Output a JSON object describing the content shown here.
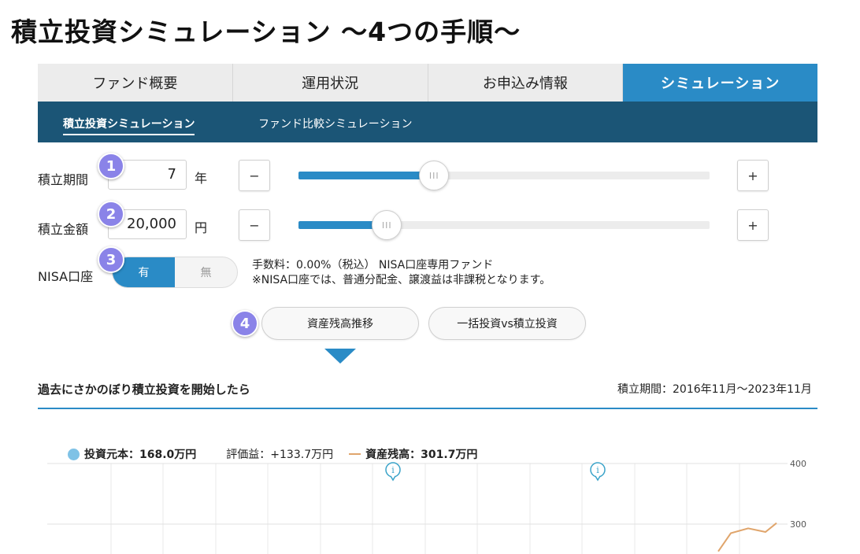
{
  "page_title": "積立投資シミュレーション 〜4つの手順〜",
  "tabs": [
    {
      "label": "ファンド概要",
      "active": false
    },
    {
      "label": "運用状況",
      "active": false
    },
    {
      "label": "お申込み情報",
      "active": false
    },
    {
      "label": "シミュレーション",
      "active": true
    }
  ],
  "subnav": [
    {
      "label": "積立投資シミュレーション",
      "active": true
    },
    {
      "label": "ファンド比較シミュレーション",
      "active": false
    }
  ],
  "steps": [
    "1",
    "2",
    "3",
    "4"
  ],
  "period": {
    "label": "積立期間",
    "value": "7",
    "unit": "年",
    "minus": "−",
    "plus": "+",
    "slider_fraction": 0.33
  },
  "amount": {
    "label": "積立金額",
    "value": "20,000",
    "unit": "円",
    "minus": "−",
    "plus": "+",
    "slider_fraction": 0.215
  },
  "nisa": {
    "label": "NISA口座",
    "on_label": "有",
    "off_label": "無",
    "fee_line1": "手数料：0.00%（税込） NISA口座専用ファンド",
    "fee_line2": "※NISA口座では、普通分配金、譲渡益は非課税となります。"
  },
  "buttons": {
    "balance": "資産残高推移",
    "compare": "一括投資vs積立投資"
  },
  "result": {
    "title": "過去にさかのぼり積立投資を開始したら",
    "period_text": "積立期間：2016年11月〜2023年11月"
  },
  "chart_data": {
    "type": "line",
    "legend": [
      {
        "label": "投資元本：",
        "value": "168.0万円",
        "color": "#7fc2e6"
      },
      {
        "label": "評価益：",
        "value": "+133.7万円"
      },
      {
        "label": "資産残高：",
        "value": "301.7万円",
        "color": "#e0a56c"
      }
    ],
    "y_ticks": [
      400,
      300
    ],
    "series": [
      {
        "values_tail": [
          255,
          285,
          293,
          287,
          301.7
        ]
      }
    ],
    "info_icons": [
      "i",
      "i"
    ]
  },
  "colors": {
    "accent": "#2a8bc6",
    "subnav": "#1b5576",
    "badge": "#8a83e8",
    "balance_line": "#e0a56c"
  }
}
